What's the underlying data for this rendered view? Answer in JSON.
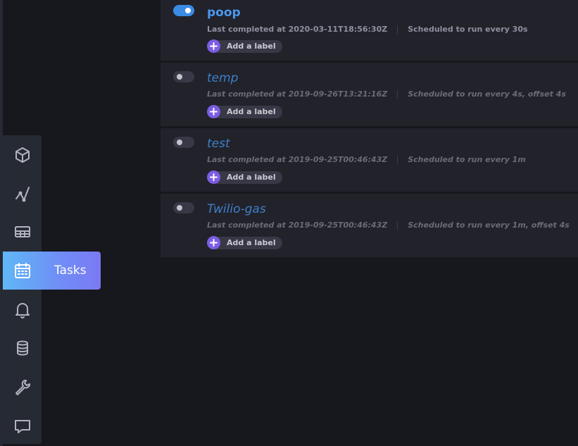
{
  "sidebar": {
    "items": [
      {
        "name": "data-explorer",
        "icon": "cube-icon"
      },
      {
        "name": "dashboards",
        "icon": "graph-icon"
      },
      {
        "name": "boards",
        "icon": "table-icon"
      },
      {
        "name": "tasks",
        "icon": "calendar-icon",
        "label": "Tasks",
        "active": true
      },
      {
        "name": "alerts",
        "icon": "bell-icon"
      },
      {
        "name": "load-data",
        "icon": "database-icon"
      },
      {
        "name": "settings",
        "icon": "wrench-icon"
      },
      {
        "name": "feedback",
        "icon": "chat-icon"
      }
    ]
  },
  "tasks": [
    {
      "name": "poop",
      "enabled": true,
      "last_completed": "Last completed at 2020-03-11T18:56:30Z",
      "schedule": "Scheduled to run every 30s",
      "label_button": "Add a label"
    },
    {
      "name": "temp",
      "enabled": false,
      "last_completed": "Last completed at 2019-09-26T13:21:16Z",
      "schedule": "Scheduled to run every 4s, offset 4s",
      "label_button": "Add a label"
    },
    {
      "name": "test",
      "enabled": false,
      "last_completed": "Last completed at 2019-09-25T00:46:43Z",
      "schedule": "Scheduled to run every 1m",
      "label_button": "Add a label"
    },
    {
      "name": "Twilio-gas",
      "enabled": false,
      "last_completed": "Last completed at 2019-09-25T00:46:43Z",
      "schedule": "Scheduled to run every 1m, offset 4s",
      "label_button": "Add a label"
    }
  ],
  "colors": {
    "background": "#17171e",
    "card": "#22222a",
    "accent_blue": "#4a98ee",
    "label_purple": "#7b5de5",
    "nav_gradient_start": "#5fb8f7",
    "nav_gradient_end": "#7b79f3"
  }
}
